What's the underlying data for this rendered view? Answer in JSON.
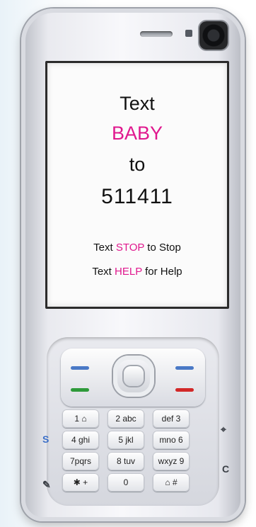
{
  "screen": {
    "line1": "Text",
    "line2": "BABY",
    "line3": "to",
    "line4": "511411",
    "stop_prefix": "Text ",
    "stop_word": "STOP",
    "stop_suffix": " to Stop",
    "help_prefix": "Text ",
    "help_word": "HELP",
    "help_suffix": " for Help"
  },
  "keys": [
    "1 ⌂",
    "2 abc",
    "def 3",
    "4 ghi",
    "5 jkl",
    "mno 6",
    "7pqrs",
    "8 tuv",
    "wxyz 9",
    "✱ +",
    "0",
    "⌂ #"
  ],
  "side_labels": {
    "left_top": "S",
    "left_bottom": "✎",
    "right_top": "⌖",
    "right_bottom": "C"
  },
  "colors": {
    "accent": "#e0188e"
  }
}
